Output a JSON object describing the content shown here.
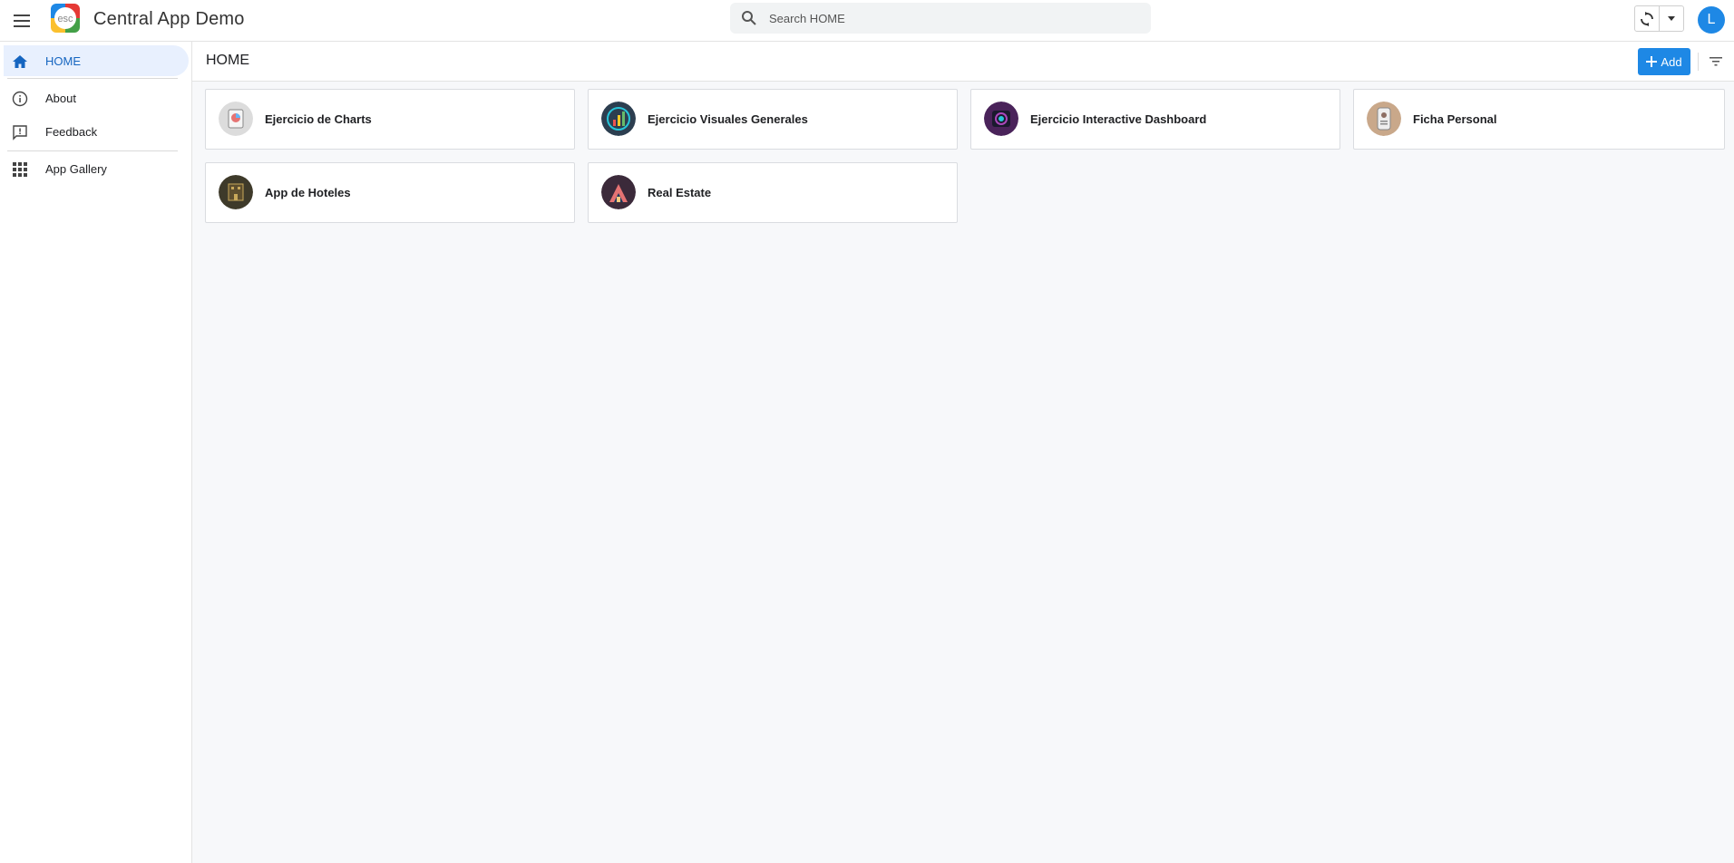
{
  "header": {
    "app_title": "Central App Demo",
    "logo_text": "esc",
    "search_placeholder": "Search HOME",
    "user_initial": "L"
  },
  "sidebar": {
    "items": [
      {
        "label": "HOME",
        "icon": "home-icon",
        "active": true
      },
      {
        "label": "About",
        "icon": "info-icon"
      },
      {
        "label": "Feedback",
        "icon": "feedback-icon"
      },
      {
        "label": "App Gallery",
        "icon": "apps-grid-icon"
      }
    ]
  },
  "main": {
    "title": "HOME",
    "add_label": "Add",
    "apps": [
      {
        "label": "Ejercicio de Charts",
        "thumb_color": "#9e9e9e"
      },
      {
        "label": "Ejercicio Visuales Generales",
        "thumb_color": "#2c3e50"
      },
      {
        "label": "Ejercicio Interactive Dashboard",
        "thumb_color": "#4a235a"
      },
      {
        "label": "Ficha Personal",
        "thumb_color": "#c9a88a"
      },
      {
        "label": "App de Hoteles",
        "thumb_color": "#3e3a2a"
      },
      {
        "label": "Real Estate",
        "thumb_color": "#3b2a3a"
      }
    ]
  },
  "colors": {
    "accent": "#1e88e5",
    "active_bg": "#e8f0fe",
    "main_bg": "#f7f8fa"
  }
}
